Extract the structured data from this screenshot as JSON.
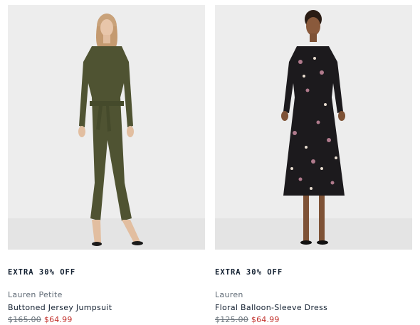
{
  "products": [
    {
      "promo": "EXTRA 30% OFF",
      "brand": "Lauren Petite",
      "name": "Buttoned Jersey Jumpsuit",
      "original_price": "$165.00",
      "sale_price": "$64.99",
      "image_color": "#4f5332"
    },
    {
      "promo": "EXTRA 30% OFF",
      "brand": "Lauren",
      "name": "Floral Balloon-Sleeve Dress",
      "original_price": "$125.00",
      "sale_price": "$64.99",
      "image_color": "#1c1a1d"
    }
  ],
  "colors": {
    "sale": "#c2312c",
    "text": "#132031",
    "muted": "#5f6a75",
    "photo_bg": "#ebebeb"
  }
}
